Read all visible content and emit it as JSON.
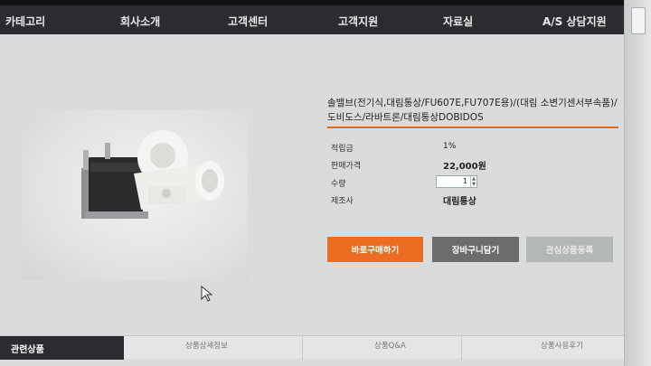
{
  "nav": {
    "items": [
      "카테고리",
      "회사소개",
      "고객센터",
      "고객지원",
      "자료실",
      "A/S 상담지원"
    ]
  },
  "product": {
    "title": "솔밸브(전기식,대림통상/FU607E,FU707E용)/(대림 소변기센서부속품)/도비도스/라바트론/대림통상DOBIDOS",
    "fields": [
      {
        "label": "적립금",
        "value": "1%"
      },
      {
        "label": "판매가격",
        "value": "22,000원"
      },
      {
        "label": "수량",
        "value": "1"
      },
      {
        "label": "제조사",
        "value": "대림통상"
      }
    ],
    "buttons": {
      "buy": "바로구매하기",
      "cart": "장바구니담기",
      "wish": "관심상품등록"
    }
  },
  "tabs": {
    "active": "관련상품",
    "items": [
      "상품상세정보",
      "상품Q&A",
      "상품사용후기"
    ]
  },
  "colors": {
    "accent": "#ec6d22",
    "nav_bg": "#2a2c2f"
  }
}
